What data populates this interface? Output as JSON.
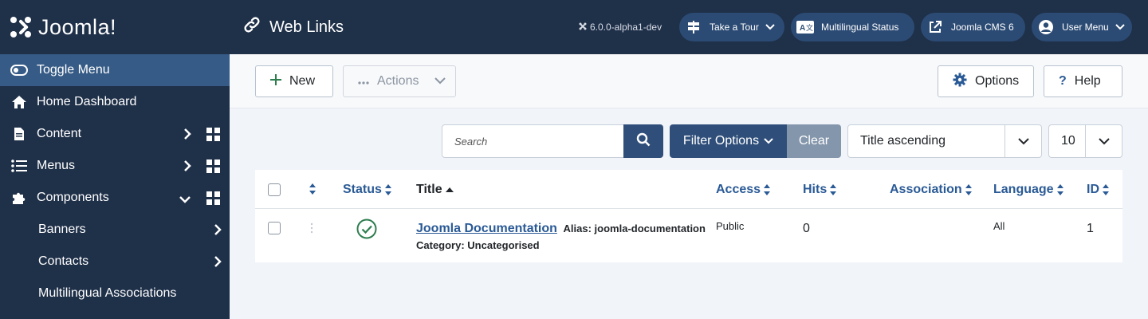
{
  "brand": {
    "name": "Joomla!"
  },
  "sidebar": {
    "toggle_label": "Toggle Menu",
    "items": [
      {
        "label": "Home Dashboard",
        "icon": "home-icon"
      },
      {
        "label": "Content",
        "icon": "file-icon"
      },
      {
        "label": "Menus",
        "icon": "list-icon"
      },
      {
        "label": "Components",
        "icon": "puzzle-icon"
      }
    ],
    "sub_items": [
      {
        "label": "Banners"
      },
      {
        "label": "Contacts"
      },
      {
        "label": "Multilingual Associations"
      }
    ]
  },
  "header": {
    "title": "Web Links",
    "version": "6.0.0-alpha1-dev",
    "buttons": [
      {
        "label": "Take a Tour"
      },
      {
        "label": "Multilingual Status"
      },
      {
        "label": "Joomla CMS 6"
      },
      {
        "label": "User Menu"
      }
    ]
  },
  "toolbar": {
    "new_label": "New",
    "actions_label": "Actions",
    "options_label": "Options",
    "help_label": "Help"
  },
  "filters": {
    "search_placeholder": "Search",
    "filter_options_label": "Filter Options",
    "clear_label": "Clear",
    "ordering": "Title ascending",
    "limit": "10"
  },
  "table": {
    "headers": {
      "status": "Status",
      "title": "Title",
      "access": "Access",
      "hits": "Hits",
      "association": "Association",
      "language": "Language",
      "id": "ID"
    },
    "rows": [
      {
        "title": "Joomla Documentation",
        "alias": "Alias: joomla-documentation",
        "category": "Category: Uncategorised",
        "access": "Public",
        "hits": "0",
        "language": "All",
        "id": "1"
      }
    ]
  },
  "colors": {
    "sidebar_bg": "#1f3049",
    "accent": "#2a5a96",
    "status_published": "#2e7d4f"
  }
}
